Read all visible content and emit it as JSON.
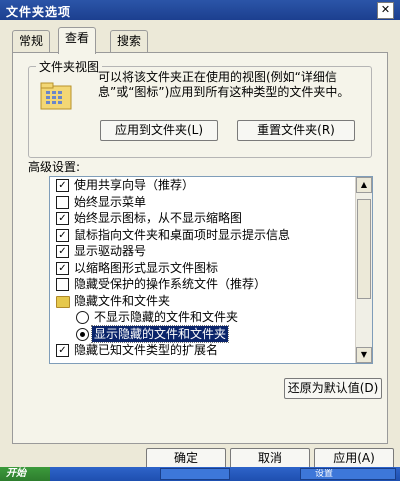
{
  "window": {
    "title": "文件夹选项"
  },
  "tabs": [
    {
      "label": "常规"
    },
    {
      "label": "查看"
    },
    {
      "label": "搜索"
    }
  ],
  "folder_views": {
    "legend": "文件夹视图",
    "description": "可以将该文件夹正在使用的视图(例如“详细信息”或“图标”)应用到所有这种类型的文件夹中。",
    "apply_button": "应用到文件夹(L)",
    "reset_button": "重置文件夹(R)"
  },
  "advanced": {
    "label": "高级设置:",
    "items": [
      {
        "type": "checkbox",
        "checked": true,
        "label": "使用共享向导（推荐）"
      },
      {
        "type": "checkbox",
        "checked": false,
        "label": "始终显示菜单"
      },
      {
        "type": "checkbox",
        "checked": true,
        "label": "始终显示图标，从不显示缩略图"
      },
      {
        "type": "checkbox",
        "checked": true,
        "label": "鼠标指向文件夹和桌面项时显示提示信息"
      },
      {
        "type": "checkbox",
        "checked": true,
        "label": "显示驱动器号"
      },
      {
        "type": "checkbox",
        "checked": true,
        "label": "以缩略图形式显示文件图标"
      },
      {
        "type": "checkbox",
        "checked": false,
        "label": "隐藏受保护的操作系统文件（推荐）"
      },
      {
        "type": "folder",
        "label": "隐藏文件和文件夹"
      },
      {
        "type": "radio",
        "checked": false,
        "label": "不显示隐藏的文件和文件夹"
      },
      {
        "type": "radio",
        "checked": true,
        "label": "显示隐藏的文件和文件夹",
        "selected": true
      },
      {
        "type": "checkbox",
        "checked": true,
        "label": "隐藏已知文件类型的扩展名"
      }
    ],
    "restore_button": "还原为默认值(D)"
  },
  "footer": {
    "ok": "确定",
    "cancel": "取消",
    "apply": "应用(A)"
  },
  "taskbar": {
    "start": "开始",
    "items": [
      "设置"
    ]
  },
  "colors": {
    "title_bar": "#1c3f8f",
    "selection": "#0a246a",
    "dialog_bg": "#ece9d8"
  }
}
